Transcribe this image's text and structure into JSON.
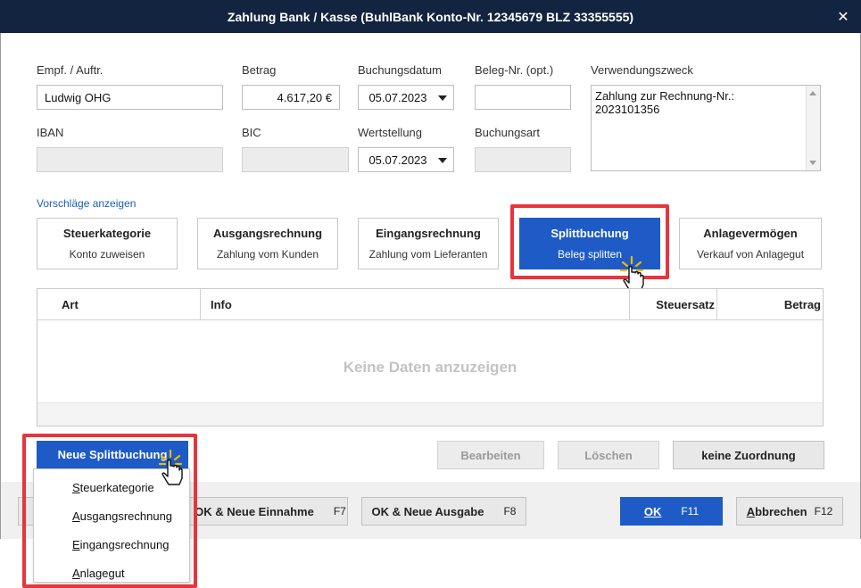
{
  "window": {
    "title": "Zahlung Bank / Kasse (BuhlBank Konto-Nr. 12345679  BLZ 33355555)",
    "close_glyph": "✕"
  },
  "form": {
    "empf_label": "Empf. / Auftr.",
    "empf_value": "Ludwig OHG",
    "betrag_label": "Betrag",
    "betrag_value": "4.617,20 €",
    "buchungsdatum_label": "Buchungsdatum",
    "buchungsdatum_value": "05.07.2023",
    "beleg_label": "Beleg-Nr. (opt.)",
    "beleg_value": "",
    "verwendungszweck_label": "Verwendungszweck",
    "verwendungszweck_value": "Zahlung zur Rechnung-Nr.: 2023101356",
    "iban_label": "IBAN",
    "iban_value": "",
    "bic_label": "BIC",
    "bic_value": "",
    "wertstellung_label": "Wertstellung",
    "wertstellung_value": "05.07.2023",
    "buchungsart_label": "Buchungsart",
    "buchungsart_value": ""
  },
  "suggestions": {
    "link": "Vorschläge anzeigen",
    "cards": [
      {
        "title": "Steuerkategorie",
        "subtitle": "Konto zuweisen"
      },
      {
        "title": "Ausgangsrechnung",
        "subtitle": "Zahlung vom Kunden"
      },
      {
        "title": "Eingangsrechnung",
        "subtitle": "Zahlung vom Lieferanten"
      },
      {
        "title": "Splittbuchung",
        "subtitle": "Beleg splitten"
      },
      {
        "title": "Anlagevermögen",
        "subtitle": "Verkauf von Anlagegut"
      }
    ]
  },
  "table": {
    "columns": [
      "Art",
      "Info",
      "Steuersatz",
      "Betrag"
    ],
    "empty_message": "Keine Daten anzuzeigen"
  },
  "actions": {
    "neue_splittbuchung": "Neue Splittbuchung",
    "bearbeiten": "Bearbeiten",
    "loeschen": "Löschen",
    "keine_zuordnung": "keine Zuordnung"
  },
  "menu": {
    "items": [
      {
        "mnemonic": "S",
        "rest": "teuerkategorie"
      },
      {
        "mnemonic": "A",
        "rest": "usgangsrechnung"
      },
      {
        "mnemonic": "E",
        "rest": "ingangsrechnung"
      },
      {
        "mnemonic": "A",
        "rest": "nlagegut"
      }
    ]
  },
  "footer": {
    "ok_einnahme": "OK & Neue Einnahme",
    "ok_einnahme_key": "F7",
    "ok_ausgabe": "OK & Neue Ausgabe",
    "ok_ausgabe_key": "F8",
    "ok": "OK",
    "ok_key": "F11",
    "abbrechen_mnemonic": "A",
    "abbrechen_rest": "bbrechen",
    "abbrechen_key": "F12"
  },
  "colors": {
    "accent": "#1e5bc6",
    "titlebar": "#12243f",
    "highlight": "#e8343c",
    "link": "#1a5fb4"
  }
}
